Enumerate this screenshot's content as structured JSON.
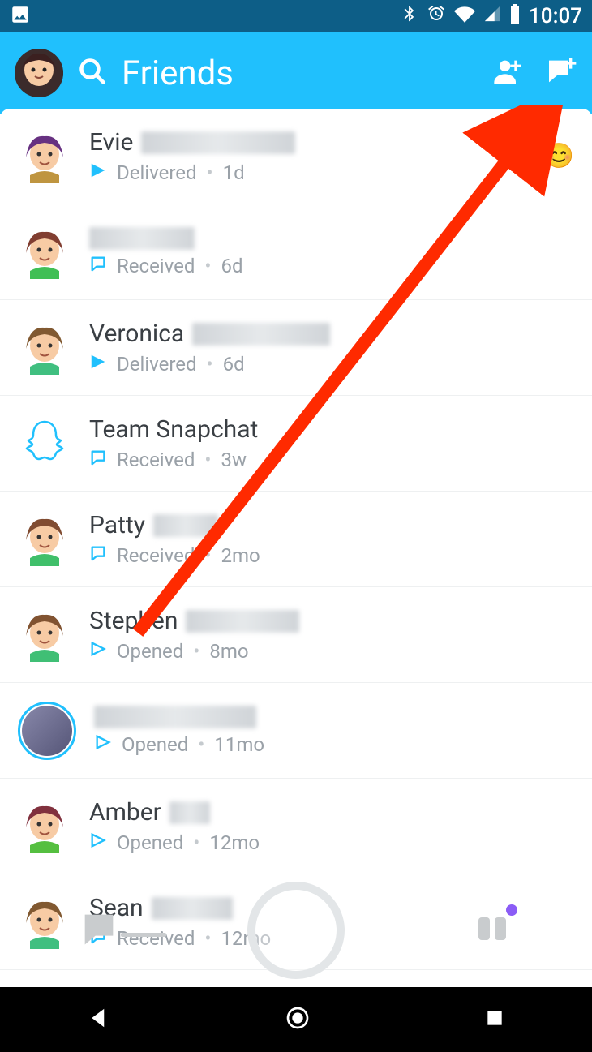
{
  "statusbar": {
    "time": "10:07"
  },
  "header": {
    "title": "Friends"
  },
  "friends": [
    {
      "name": "Evie",
      "name_blur_w": 190,
      "status_icon": "sent-filled",
      "status": "Delivered",
      "time": "1d",
      "emoji": "😊",
      "avatar_hue": 280
    },
    {
      "name": "",
      "name_blur_w": 130,
      "status_icon": "chat-received",
      "status": "Received",
      "time": "6d",
      "avatar_hue": 10
    },
    {
      "name": "Veronica",
      "name_blur_w": 170,
      "status_icon": "sent-filled",
      "status": "Delivered",
      "time": "6d",
      "avatar_hue": 30
    },
    {
      "name": "Team Snapchat",
      "status_icon": "chat-received",
      "status": "Received",
      "time": "3w",
      "ghost": true
    },
    {
      "name": "Patty",
      "name_blur_w": 80,
      "status_icon": "chat-received",
      "status": "Received",
      "time": "2mo",
      "avatar_hue": 20
    },
    {
      "name": "Stephen",
      "name_blur_w": 140,
      "status_icon": "sent-outline",
      "status": "Opened",
      "time": "8mo",
      "avatar_hue": 25
    },
    {
      "name": "",
      "name_blur_w": 200,
      "status_icon": "sent-outline",
      "status": "Opened",
      "time": "11mo",
      "story_ring": true,
      "avatar_hue": 200
    },
    {
      "name": "Amber",
      "name_blur_w": 50,
      "status_icon": "sent-outline",
      "status": "Opened",
      "time": "12mo",
      "avatar_hue": 350
    },
    {
      "name": "Sean",
      "name_blur_w": 100,
      "status_icon": "chat-received",
      "status": "Received",
      "time": "12mo",
      "avatar_hue": 30
    }
  ]
}
